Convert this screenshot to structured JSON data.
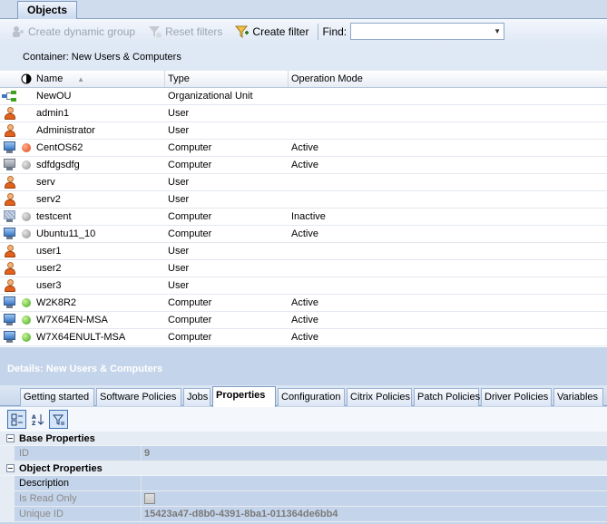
{
  "top_tab": "Objects",
  "toolbar": {
    "create_dynamic_group": "Create dynamic group",
    "reset_filters": "Reset filters",
    "create_filter": "Create filter",
    "find_label": "Find:",
    "find_value": ""
  },
  "container_label": "Container: New Users & Computers",
  "grid": {
    "columns": {
      "name": "Name",
      "type": "Type",
      "mode": "Operation Mode"
    },
    "rows": [
      {
        "icon": "ou-icon",
        "status": "",
        "name": "NewOU",
        "type": "Organizational Unit",
        "mode": ""
      },
      {
        "icon": "user-icon",
        "status": "",
        "name": "admin1",
        "type": "User",
        "mode": ""
      },
      {
        "icon": "user-icon",
        "status": "",
        "name": "Administrator",
        "type": "User",
        "mode": ""
      },
      {
        "icon": "computer-icon",
        "status": "red",
        "name": "CentOS62",
        "type": "Computer",
        "mode": "Active"
      },
      {
        "icon": "computer-gray-icon",
        "status": "gray",
        "name": "sdfdgsdfg",
        "type": "Computer",
        "mode": "Active"
      },
      {
        "icon": "user-icon",
        "status": "",
        "name": "serv",
        "type": "User",
        "mode": ""
      },
      {
        "icon": "user-icon",
        "status": "",
        "name": "serv2",
        "type": "User",
        "mode": ""
      },
      {
        "icon": "computer-inactive-icon",
        "status": "gray",
        "name": "testcent",
        "type": "Computer",
        "mode": "Inactive"
      },
      {
        "icon": "computer-icon",
        "status": "gray",
        "name": "Ubuntu11_10",
        "type": "Computer",
        "mode": "Active"
      },
      {
        "icon": "user-icon",
        "status": "",
        "name": "user1",
        "type": "User",
        "mode": ""
      },
      {
        "icon": "user-icon",
        "status": "",
        "name": "user2",
        "type": "User",
        "mode": ""
      },
      {
        "icon": "user-icon",
        "status": "",
        "name": "user3",
        "type": "User",
        "mode": ""
      },
      {
        "icon": "computer-icon",
        "status": "green",
        "name": "W2K8R2",
        "type": "Computer",
        "mode": "Active"
      },
      {
        "icon": "computer-icon",
        "status": "green",
        "name": "W7X64EN-MSA",
        "type": "Computer",
        "mode": "Active"
      },
      {
        "icon": "computer-icon",
        "status": "green",
        "name": "W7X64ENULT-MSA",
        "type": "Computer",
        "mode": "Active"
      }
    ]
  },
  "details": {
    "title": "Details: New Users & Computers",
    "tabs": [
      "Getting started",
      "Software Policies",
      "Jobs",
      "Properties",
      "Configuration",
      "Citrix Policies",
      "Patch Policies",
      "Driver Policies",
      "Variables"
    ],
    "active_tab": "Properties",
    "categories": {
      "base": "Base Properties",
      "object": "Object Properties"
    },
    "props": {
      "id_label": "ID",
      "id_value": "9",
      "description_label": "Description",
      "description_value": "",
      "readonly_label": "Is Read Only",
      "uniqueid_label": "Unique ID",
      "uniqueid_value": "15423a47-d8b0-4391-8ba1-011364de6bb4"
    }
  }
}
